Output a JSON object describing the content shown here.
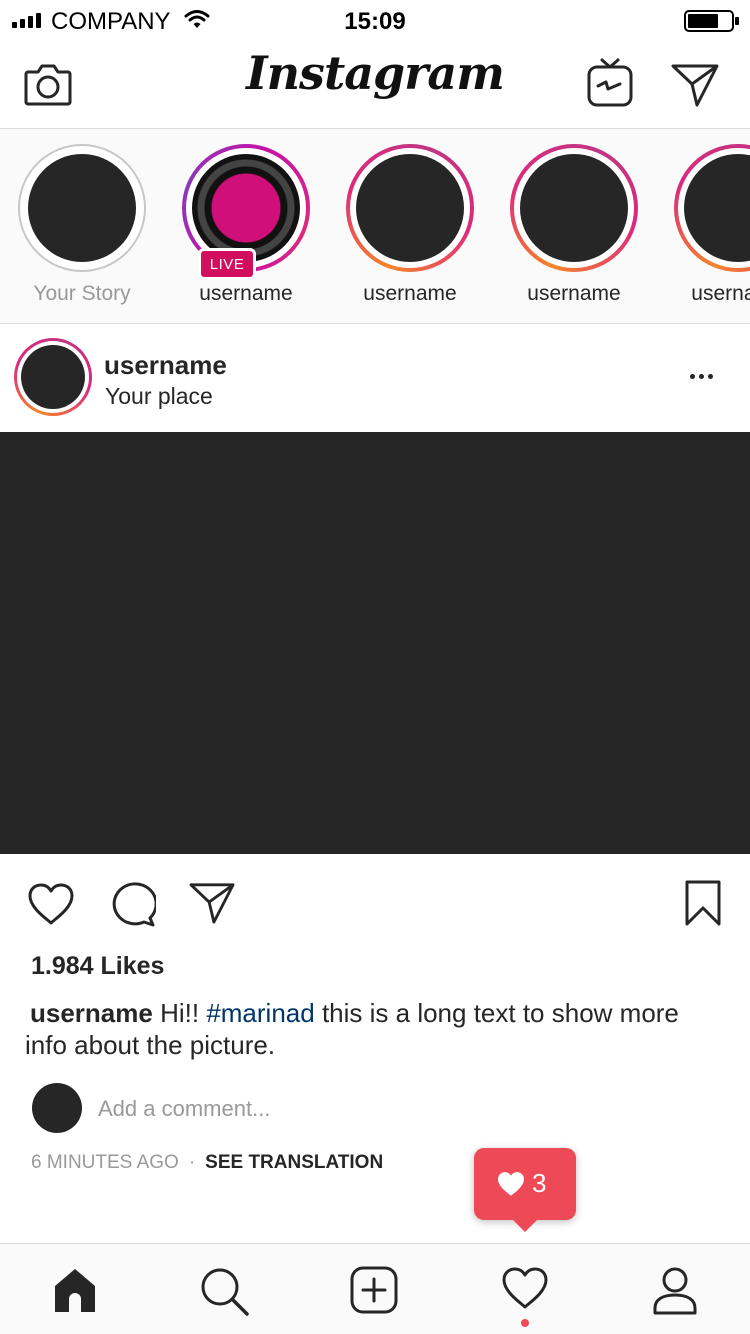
{
  "status_bar": {
    "carrier": "COMPANY",
    "time": "15:09"
  },
  "header": {
    "logo": "Instagram",
    "icons": [
      "camera-icon",
      "igtv-icon",
      "direct-message-icon"
    ]
  },
  "stories": [
    {
      "name": "Your Story",
      "own": true
    },
    {
      "name": "username",
      "live": true,
      "badge": "LIVE"
    },
    {
      "name": "username"
    },
    {
      "name": "username"
    },
    {
      "name": "username"
    }
  ],
  "post": {
    "username": "username",
    "location": "Your place",
    "likes": "1.984 Likes",
    "caption": {
      "username": "username",
      "before_tag": "Hi!!",
      "hashtag": "#marinad",
      "after_tag": "this is a long text to show more info about the picture."
    },
    "comment_placeholder": "Add a comment...",
    "time_ago": "6 MINUTES AGO",
    "separator": "·",
    "translation_link": "SEE TRANSLATION"
  },
  "notification": {
    "likes_count": "3",
    "color": "#ed4956"
  },
  "bottom_nav": {
    "items": [
      "home-icon",
      "search-icon",
      "add-post-icon",
      "activity-heart-icon",
      "profile-icon"
    ],
    "active": "home-icon"
  },
  "colors": {
    "hashtag": "#003569",
    "live_badge": "#d10f5e",
    "placeholder_dark": "#262626",
    "divider": "#dbdbdb"
  }
}
